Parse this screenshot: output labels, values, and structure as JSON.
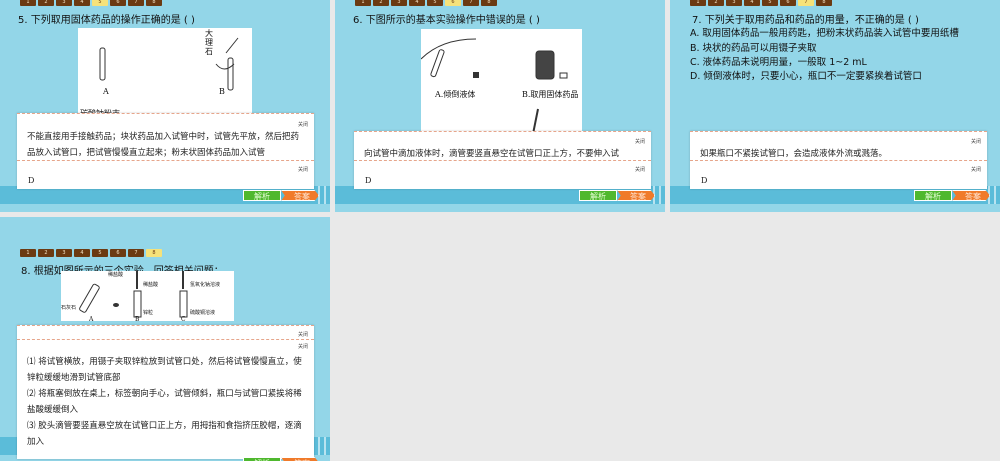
{
  "nav_numbers": [
    "1",
    "2",
    "3",
    "4",
    "5",
    "6",
    "7",
    "8"
  ],
  "close_label": "关闭",
  "analysis_label": "解析",
  "answer_label": "答案",
  "slides": [
    {
      "active": 5,
      "question": "5. 下列取用固体药品的操作正确的是 (          )",
      "figure": {
        "labels": [
          "A",
          "B",
          "大",
          "理",
          "石"
        ],
        "cut_label": "碳酸钠粉末"
      },
      "explanation": "不能直接用手接触药品；块状药品加入试管中时，试管先平放，然后把药品放入试管口，把试管慢慢直立起来；粉末状固体药品加入试管",
      "answer": "D"
    },
    {
      "active": 6,
      "question": "6. 下图所示的基本实验操作中错误的是 (          )",
      "figure": {
        "labels": [
          "A.倾倒液体",
          "B.取用固体药品"
        ]
      },
      "explanation": "向试管中滴加液体时，滴管要竖直悬空在试管口正上方，不要伸入试",
      "answer": "D"
    },
    {
      "active": 7,
      "question": "7. 下列关于取用药品和药品的用量，不正确的是 (          )",
      "options": [
        "A. 取用固体药品一般用药匙，把粉末状药品装入试管中要用纸槽",
        "B. 块状的药品可以用镊子夹取",
        "C. 液体药品未说明用量，一般取 1~2 mL",
        "D. 倾倒液体时，只要小心，瓶口不一定要紧挨着试管口"
      ],
      "explanation": "如果瓶口不紧挨试管口，会造成液体外流或溅落。",
      "answer": "D"
    },
    {
      "active": 8,
      "question": "8. 根据如图所示的三个实验，回答相关问题：",
      "figure": {
        "labels": [
          "稀盐酸",
          "石灰石",
          "A",
          "稀盐酸",
          "锌粒",
          "B",
          "氢氧化钠溶液",
          "硫酸铜溶液",
          "C"
        ]
      },
      "explanation_lines": [
        "⑴ 将试管横放，用镊子夹取锌粒放到试管口处，然后将试管慢慢直立，使锌粒缓缓地滑到试管底部",
        "⑵ 将瓶塞倒放在桌上，标签朝向手心，试管倾斜，瓶口与试管口紧挨将稀盐酸缓缓倒入",
        "⑶ 胶头滴管要竖直悬空放在试管口正上方，用拇指和食指挤压胶帽，逐滴加入"
      ]
    }
  ]
}
